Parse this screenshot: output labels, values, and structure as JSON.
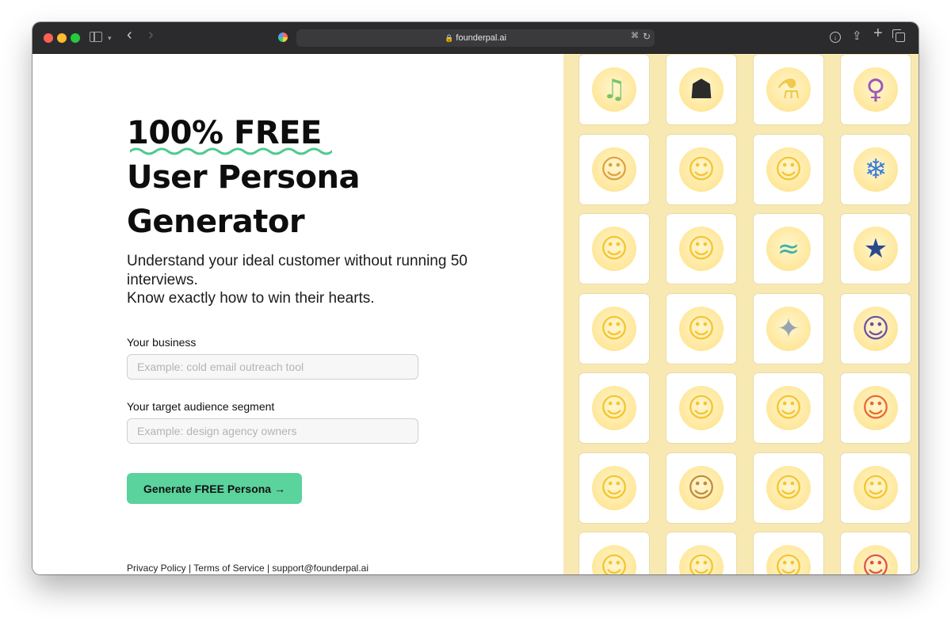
{
  "browser": {
    "url": "founderpal.ai"
  },
  "hero": {
    "line1": "100% FREE",
    "line2": "User Persona",
    "line3": "Generator",
    "subtitle_line1": "Understand your ideal customer without running 50 interviews.",
    "subtitle_line2": "Know exactly how to win their hearts."
  },
  "form": {
    "business_label": "Your business",
    "business_placeholder": "Example: cold email outreach tool",
    "audience_label": "Your target audience segment",
    "audience_placeholder": "Example: design agency owners",
    "submit_label": "Generate FREE Persona →"
  },
  "footer": {
    "privacy": "Privacy Policy",
    "terms": "Terms of Service",
    "email": "support@founderpal.ai",
    "separator": " | "
  },
  "colors": {
    "accent_green": "#5ad39c",
    "panel_yellow": "#f8e9b3",
    "squiggle": "#4ecb8f"
  },
  "persona_cards": [
    {
      "icon": "green-hair-singer-icon",
      "glyph": "♫",
      "color": "#79c36a"
    },
    {
      "icon": "ninja-icon",
      "glyph": "☗",
      "color": "#2b2b2b"
    },
    {
      "icon": "woman-scientist-icon",
      "glyph": "⚗",
      "color": "#f2c94c"
    },
    {
      "icon": "pregnant-woman-icon",
      "glyph": "♀",
      "color": "#9b59b6"
    },
    {
      "icon": "bearded-man-icon",
      "glyph": "☺",
      "color": "#e0a040"
    },
    {
      "icon": "man-in-tuxedo-icon",
      "glyph": "☺",
      "color": "#f4c430"
    },
    {
      "icon": "bride-with-veil-icon",
      "glyph": "☺",
      "color": "#f4c430"
    },
    {
      "icon": "snowboarder-icon",
      "glyph": "❄",
      "color": "#3b7dd8"
    },
    {
      "icon": "man-teacher-icon",
      "glyph": "☺",
      "color": "#f4c430"
    },
    {
      "icon": "woman-welder-icon",
      "glyph": "☺",
      "color": "#f4c430"
    },
    {
      "icon": "surfer-icon",
      "glyph": "≈",
      "color": "#3bb3a0"
    },
    {
      "icon": "police-officer-icon",
      "glyph": "★",
      "color": "#2c4a8a"
    },
    {
      "icon": "older-woman-icon",
      "glyph": "☺",
      "color": "#f4c430"
    },
    {
      "icon": "person-feeding-baby-icon",
      "glyph": "☺",
      "color": "#f4c430"
    },
    {
      "icon": "astronaut-icon",
      "glyph": "✦",
      "color": "#9aa4b0"
    },
    {
      "icon": "woman-with-headscarf-icon",
      "glyph": "☺",
      "color": "#6c4fa3"
    },
    {
      "icon": "man-icon",
      "glyph": "☺",
      "color": "#f4c430"
    },
    {
      "icon": "cook-icon",
      "glyph": "☺",
      "color": "#f4c430"
    },
    {
      "icon": "woman-teacher-icon",
      "glyph": "☺",
      "color": "#f4c430"
    },
    {
      "icon": "red-haired-woman-icon",
      "glyph": "☺",
      "color": "#e8692e"
    },
    {
      "icon": "curly-haired-man-icon",
      "glyph": "☺",
      "color": "#f4c430"
    },
    {
      "icon": "farmer-icon",
      "glyph": "☺",
      "color": "#c08a3e"
    },
    {
      "icon": "person-with-turban-icon",
      "glyph": "☺",
      "color": "#f4c430"
    },
    {
      "icon": "woman-icon",
      "glyph": "☺",
      "color": "#f4c430"
    },
    {
      "icon": "man-with-beret-icon",
      "glyph": "☺",
      "color": "#f4c430"
    },
    {
      "icon": "weightlifter-icon",
      "glyph": "☺",
      "color": "#f4c430"
    },
    {
      "icon": "blond-man-icon",
      "glyph": "☺",
      "color": "#f4c430"
    },
    {
      "icon": "cyclist-icon",
      "glyph": "☺",
      "color": "#e0504a"
    }
  ]
}
